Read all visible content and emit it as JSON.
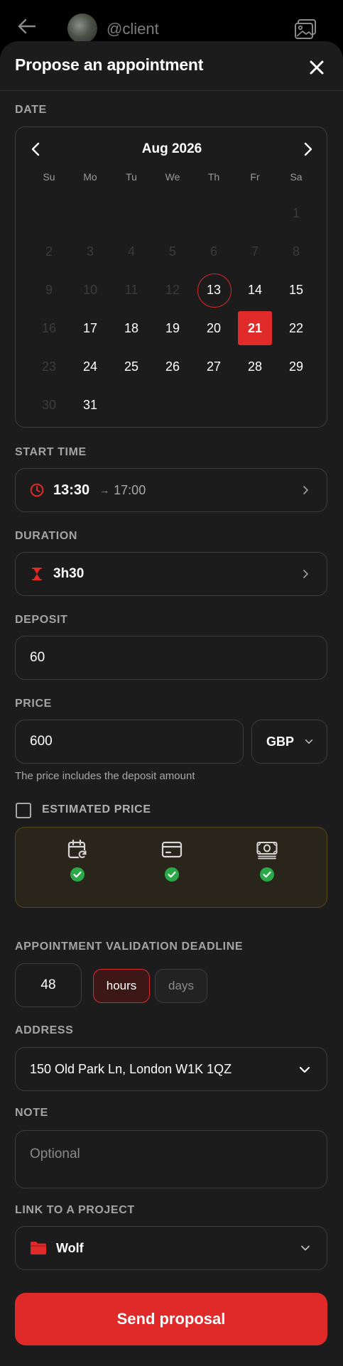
{
  "header": {
    "handle": "@client"
  },
  "sheet": {
    "title": "Propose an appointment"
  },
  "date": {
    "label": "DATE",
    "month": "Aug 2026",
    "weekdays": [
      "Su",
      "Mo",
      "Tu",
      "We",
      "Th",
      "Fr",
      "Sa"
    ],
    "days": [
      {
        "n": "",
        "state": "empty"
      },
      {
        "n": "",
        "state": "empty"
      },
      {
        "n": "",
        "state": "empty"
      },
      {
        "n": "",
        "state": "empty"
      },
      {
        "n": "",
        "state": "empty"
      },
      {
        "n": "",
        "state": "empty"
      },
      {
        "n": "1",
        "state": "disabled"
      },
      {
        "n": "2",
        "state": "disabled"
      },
      {
        "n": "3",
        "state": "disabled"
      },
      {
        "n": "4",
        "state": "disabled"
      },
      {
        "n": "5",
        "state": "disabled"
      },
      {
        "n": "6",
        "state": "disabled"
      },
      {
        "n": "7",
        "state": "disabled"
      },
      {
        "n": "8",
        "state": "disabled"
      },
      {
        "n": "9",
        "state": "disabled"
      },
      {
        "n": "10",
        "state": "disabled"
      },
      {
        "n": "11",
        "state": "disabled"
      },
      {
        "n": "12",
        "state": "disabled"
      },
      {
        "n": "13",
        "state": "today"
      },
      {
        "n": "14",
        "state": "available"
      },
      {
        "n": "15",
        "state": "available"
      },
      {
        "n": "16",
        "state": "disabled"
      },
      {
        "n": "17",
        "state": "available"
      },
      {
        "n": "18",
        "state": "available"
      },
      {
        "n": "19",
        "state": "available"
      },
      {
        "n": "20",
        "state": "available"
      },
      {
        "n": "21",
        "state": "selected"
      },
      {
        "n": "22",
        "state": "available"
      },
      {
        "n": "23",
        "state": "disabled"
      },
      {
        "n": "24",
        "state": "available"
      },
      {
        "n": "25",
        "state": "available"
      },
      {
        "n": "26",
        "state": "available"
      },
      {
        "n": "27",
        "state": "available"
      },
      {
        "n": "28",
        "state": "available"
      },
      {
        "n": "29",
        "state": "available"
      },
      {
        "n": "30",
        "state": "disabled"
      },
      {
        "n": "31",
        "state": "available"
      }
    ]
  },
  "start_time": {
    "label": "START TIME",
    "start": "13:30",
    "arrow": "→",
    "end": "17:00",
    "icon": "clock-icon"
  },
  "duration": {
    "label": "DURATION",
    "value": "3h30",
    "icon": "hourglass-icon"
  },
  "deposit": {
    "label": "DEPOSIT",
    "value": "60"
  },
  "price": {
    "label": "PRICE",
    "value": "600",
    "currency": "GBP",
    "hint": "The price includes the deposit amount"
  },
  "estimated_price": {
    "label": "ESTIMATED PRICE",
    "checked": false,
    "icons": [
      "calendar-sync-icon",
      "card-icon",
      "cash-icon"
    ]
  },
  "deadline": {
    "label": "APPOINTMENT VALIDATION DEADLINE",
    "value": "48",
    "unit_hours": "hours",
    "unit_days": "days",
    "selected_unit": "hours"
  },
  "address": {
    "label": "ADDRESS",
    "value": "150 Old Park Ln, London W1K 1QZ"
  },
  "note": {
    "label": "NOTE",
    "placeholder": "Optional"
  },
  "project": {
    "label": "LINK TO A PROJECT",
    "value": "Wolf",
    "icon": "folder-icon"
  },
  "submit": {
    "label": "Send proposal"
  },
  "colors": {
    "accent": "#e12a2a",
    "background": "#1c1c1c",
    "success": "#2aa84a",
    "estimated_panel": "#29251a"
  }
}
